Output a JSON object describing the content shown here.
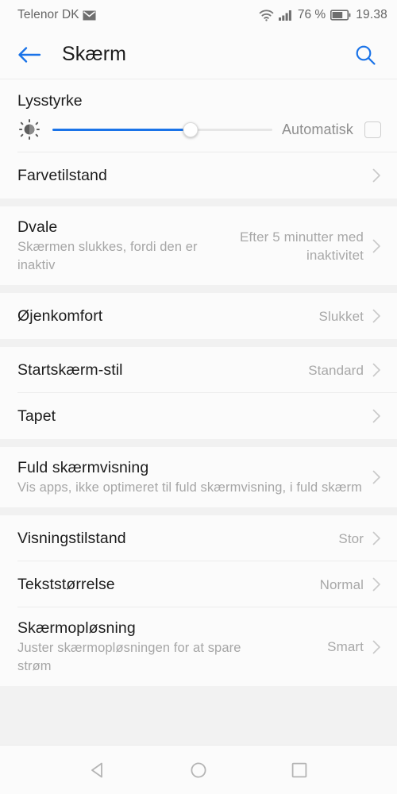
{
  "statusbar": {
    "carrier": "Telenor DK",
    "mail_icon": "envelope-icon",
    "wifi_icon": "wifi-icon",
    "signal_icon": "cellular-signal-icon",
    "battery_percent": "76 %",
    "battery_icon": "battery-icon",
    "battery_level": 65,
    "time": "19.38"
  },
  "header": {
    "back_icon": "arrow-left-icon",
    "title": "Skærm",
    "search_icon": "search-icon",
    "accent_color": "#1a73e8"
  },
  "brightness": {
    "title": "Lysstyrke",
    "sun_icon": "brightness-sun-icon",
    "slider_value": 63,
    "auto_label": "Automatisk",
    "auto_checked": false
  },
  "sections": [
    {
      "rows": [
        {
          "title": "Farvetilstand",
          "subtitle": "",
          "value": "",
          "chevron": true
        }
      ]
    },
    {
      "rows": [
        {
          "title": "Dvale",
          "subtitle": "Skærmen slukkes, fordi den er inaktiv",
          "value": "Efter 5 minutter med inaktivitet",
          "chevron": true
        }
      ]
    },
    {
      "rows": [
        {
          "title": "Øjenkomfort",
          "subtitle": "",
          "value": "Slukket",
          "chevron": true
        }
      ]
    },
    {
      "rows": [
        {
          "title": "Startskærm-stil",
          "subtitle": "",
          "value": "Standard",
          "chevron": true
        },
        {
          "title": "Tapet",
          "subtitle": "",
          "value": "",
          "chevron": true
        }
      ]
    },
    {
      "rows": [
        {
          "title": "Fuld skærmvisning",
          "subtitle": "Vis apps, ikke optimeret til fuld skærmvisning, i fuld skærm",
          "value": "",
          "chevron": true
        }
      ]
    },
    {
      "rows": [
        {
          "title": "Visningstilstand",
          "subtitle": "",
          "value": "Stor",
          "chevron": true
        },
        {
          "title": "Tekststørrelse",
          "subtitle": "",
          "value": "Normal",
          "chevron": true
        },
        {
          "title": "Skærmopløsning",
          "subtitle": "Juster skærmopløsningen for at spare strøm",
          "value": "Smart",
          "chevron": true
        }
      ]
    }
  ],
  "navbar": {
    "back_icon": "nav-back-triangle-icon",
    "home_icon": "nav-home-circle-icon",
    "recents_icon": "nav-recents-square-icon"
  }
}
